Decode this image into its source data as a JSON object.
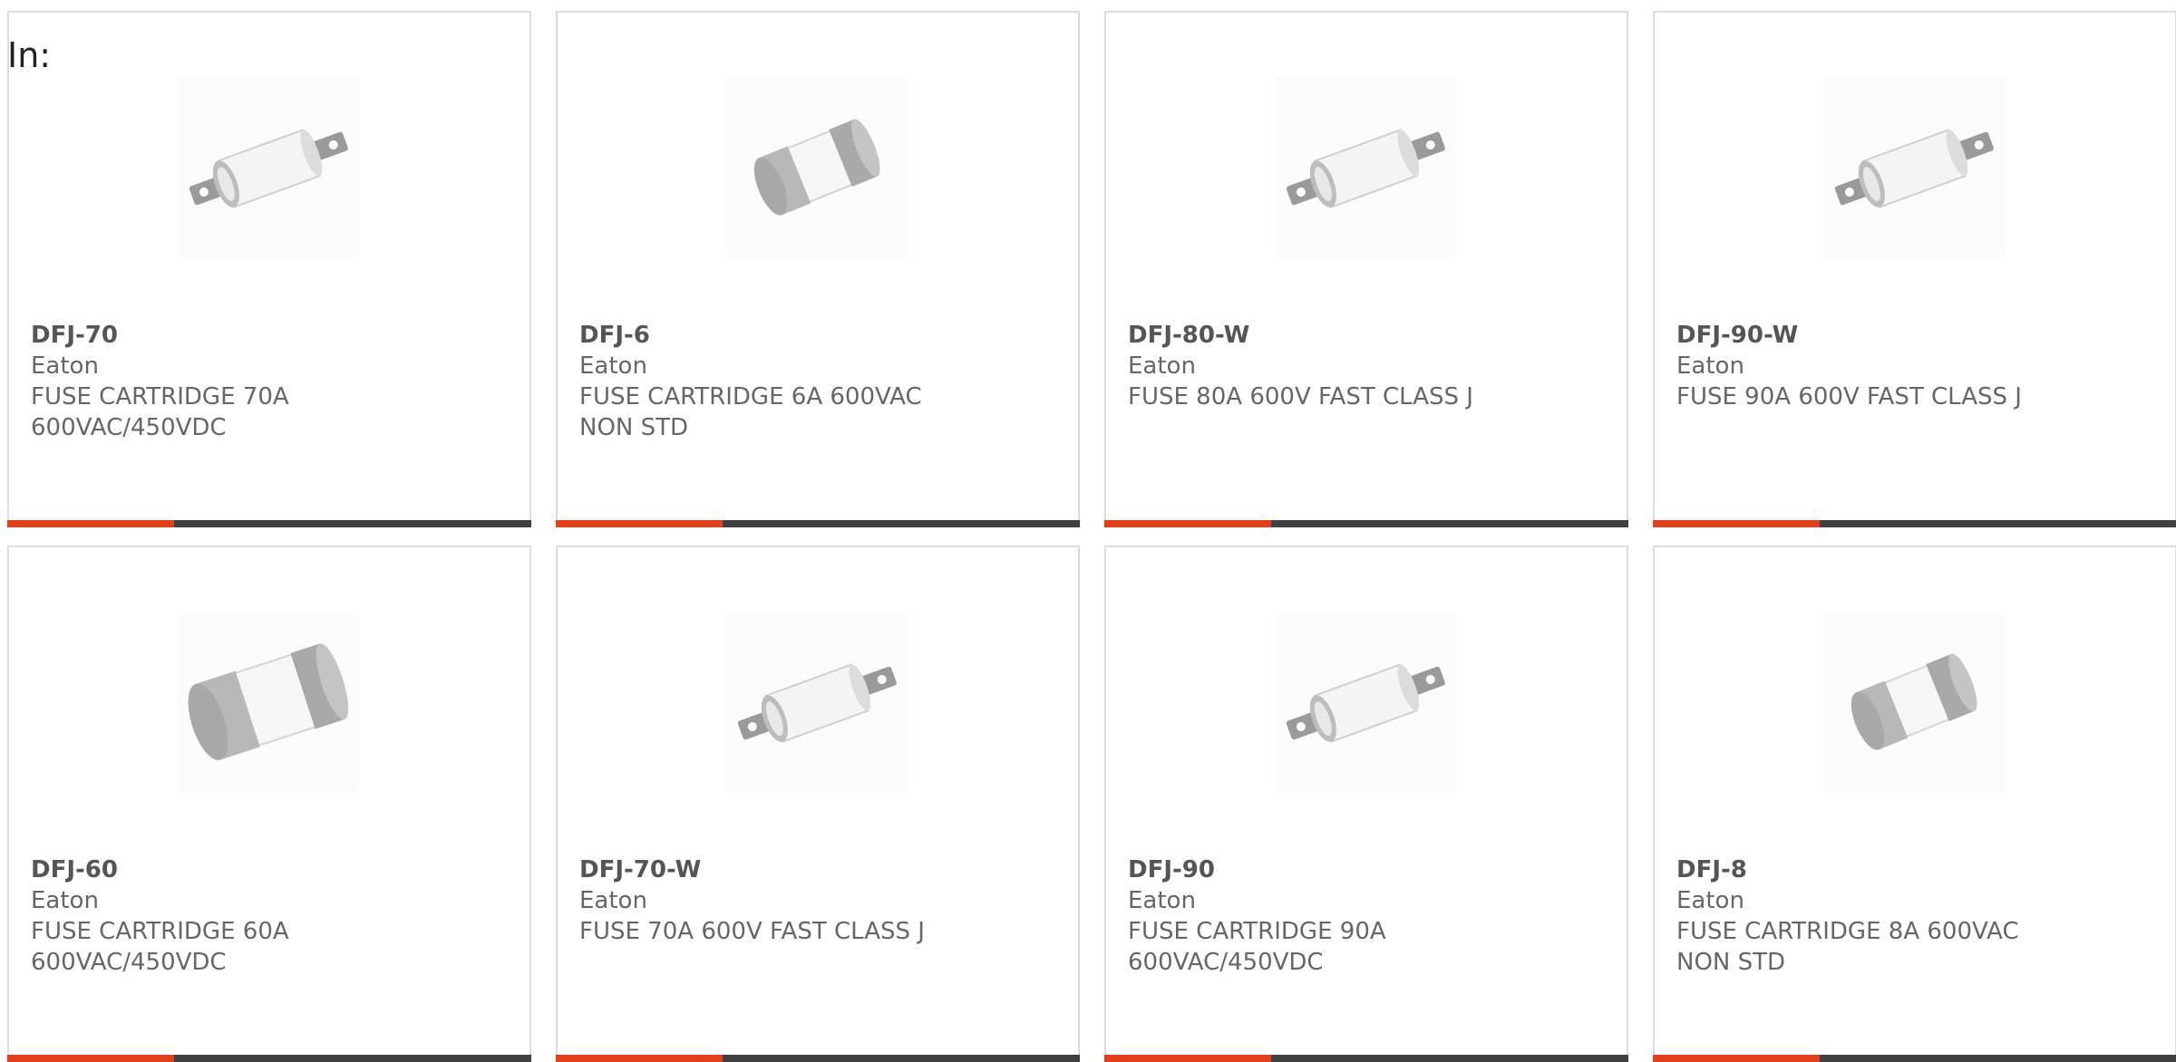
{
  "header": {
    "in_label": "In:"
  },
  "colors": {
    "accent": "#e2401c",
    "bar": "#404040",
    "text": "#666666",
    "border": "#dddddd"
  },
  "products": [
    {
      "part_number": "DFJ-70",
      "brand": "Eaton",
      "description": "FUSE CARTRIDGE 70A 600VAC/450VDC",
      "image_icon": "fuse-bolt-tab-icon"
    },
    {
      "part_number": "DFJ-6",
      "brand": "Eaton",
      "description": "FUSE CARTRIDGE 6A 600VAC NON STD",
      "image_icon": "fuse-ferrule-icon"
    },
    {
      "part_number": "DFJ-80-W",
      "brand": "Eaton",
      "description": "FUSE 80A 600V FAST CLASS J",
      "image_icon": "fuse-bolt-tab-icon"
    },
    {
      "part_number": "DFJ-90-W",
      "brand": "Eaton",
      "description": "FUSE 90A 600V FAST CLASS J",
      "image_icon": "fuse-bolt-tab-icon"
    },
    {
      "part_number": "DFJ-60",
      "brand": "Eaton",
      "description": "FUSE CARTRIDGE 60A 600VAC/450VDC",
      "image_icon": "fuse-ferrule-icon"
    },
    {
      "part_number": "DFJ-70-W",
      "brand": "Eaton",
      "description": "FUSE 70A 600V FAST CLASS J",
      "image_icon": "fuse-bolt-tab-icon"
    },
    {
      "part_number": "DFJ-90",
      "brand": "Eaton",
      "description": "FUSE CARTRIDGE 90A 600VAC/450VDC",
      "image_icon": "fuse-bolt-tab-icon"
    },
    {
      "part_number": "DFJ-8",
      "brand": "Eaton",
      "description": "FUSE CARTRIDGE 8A 600VAC NON STD",
      "image_icon": "fuse-ferrule-icon"
    }
  ]
}
